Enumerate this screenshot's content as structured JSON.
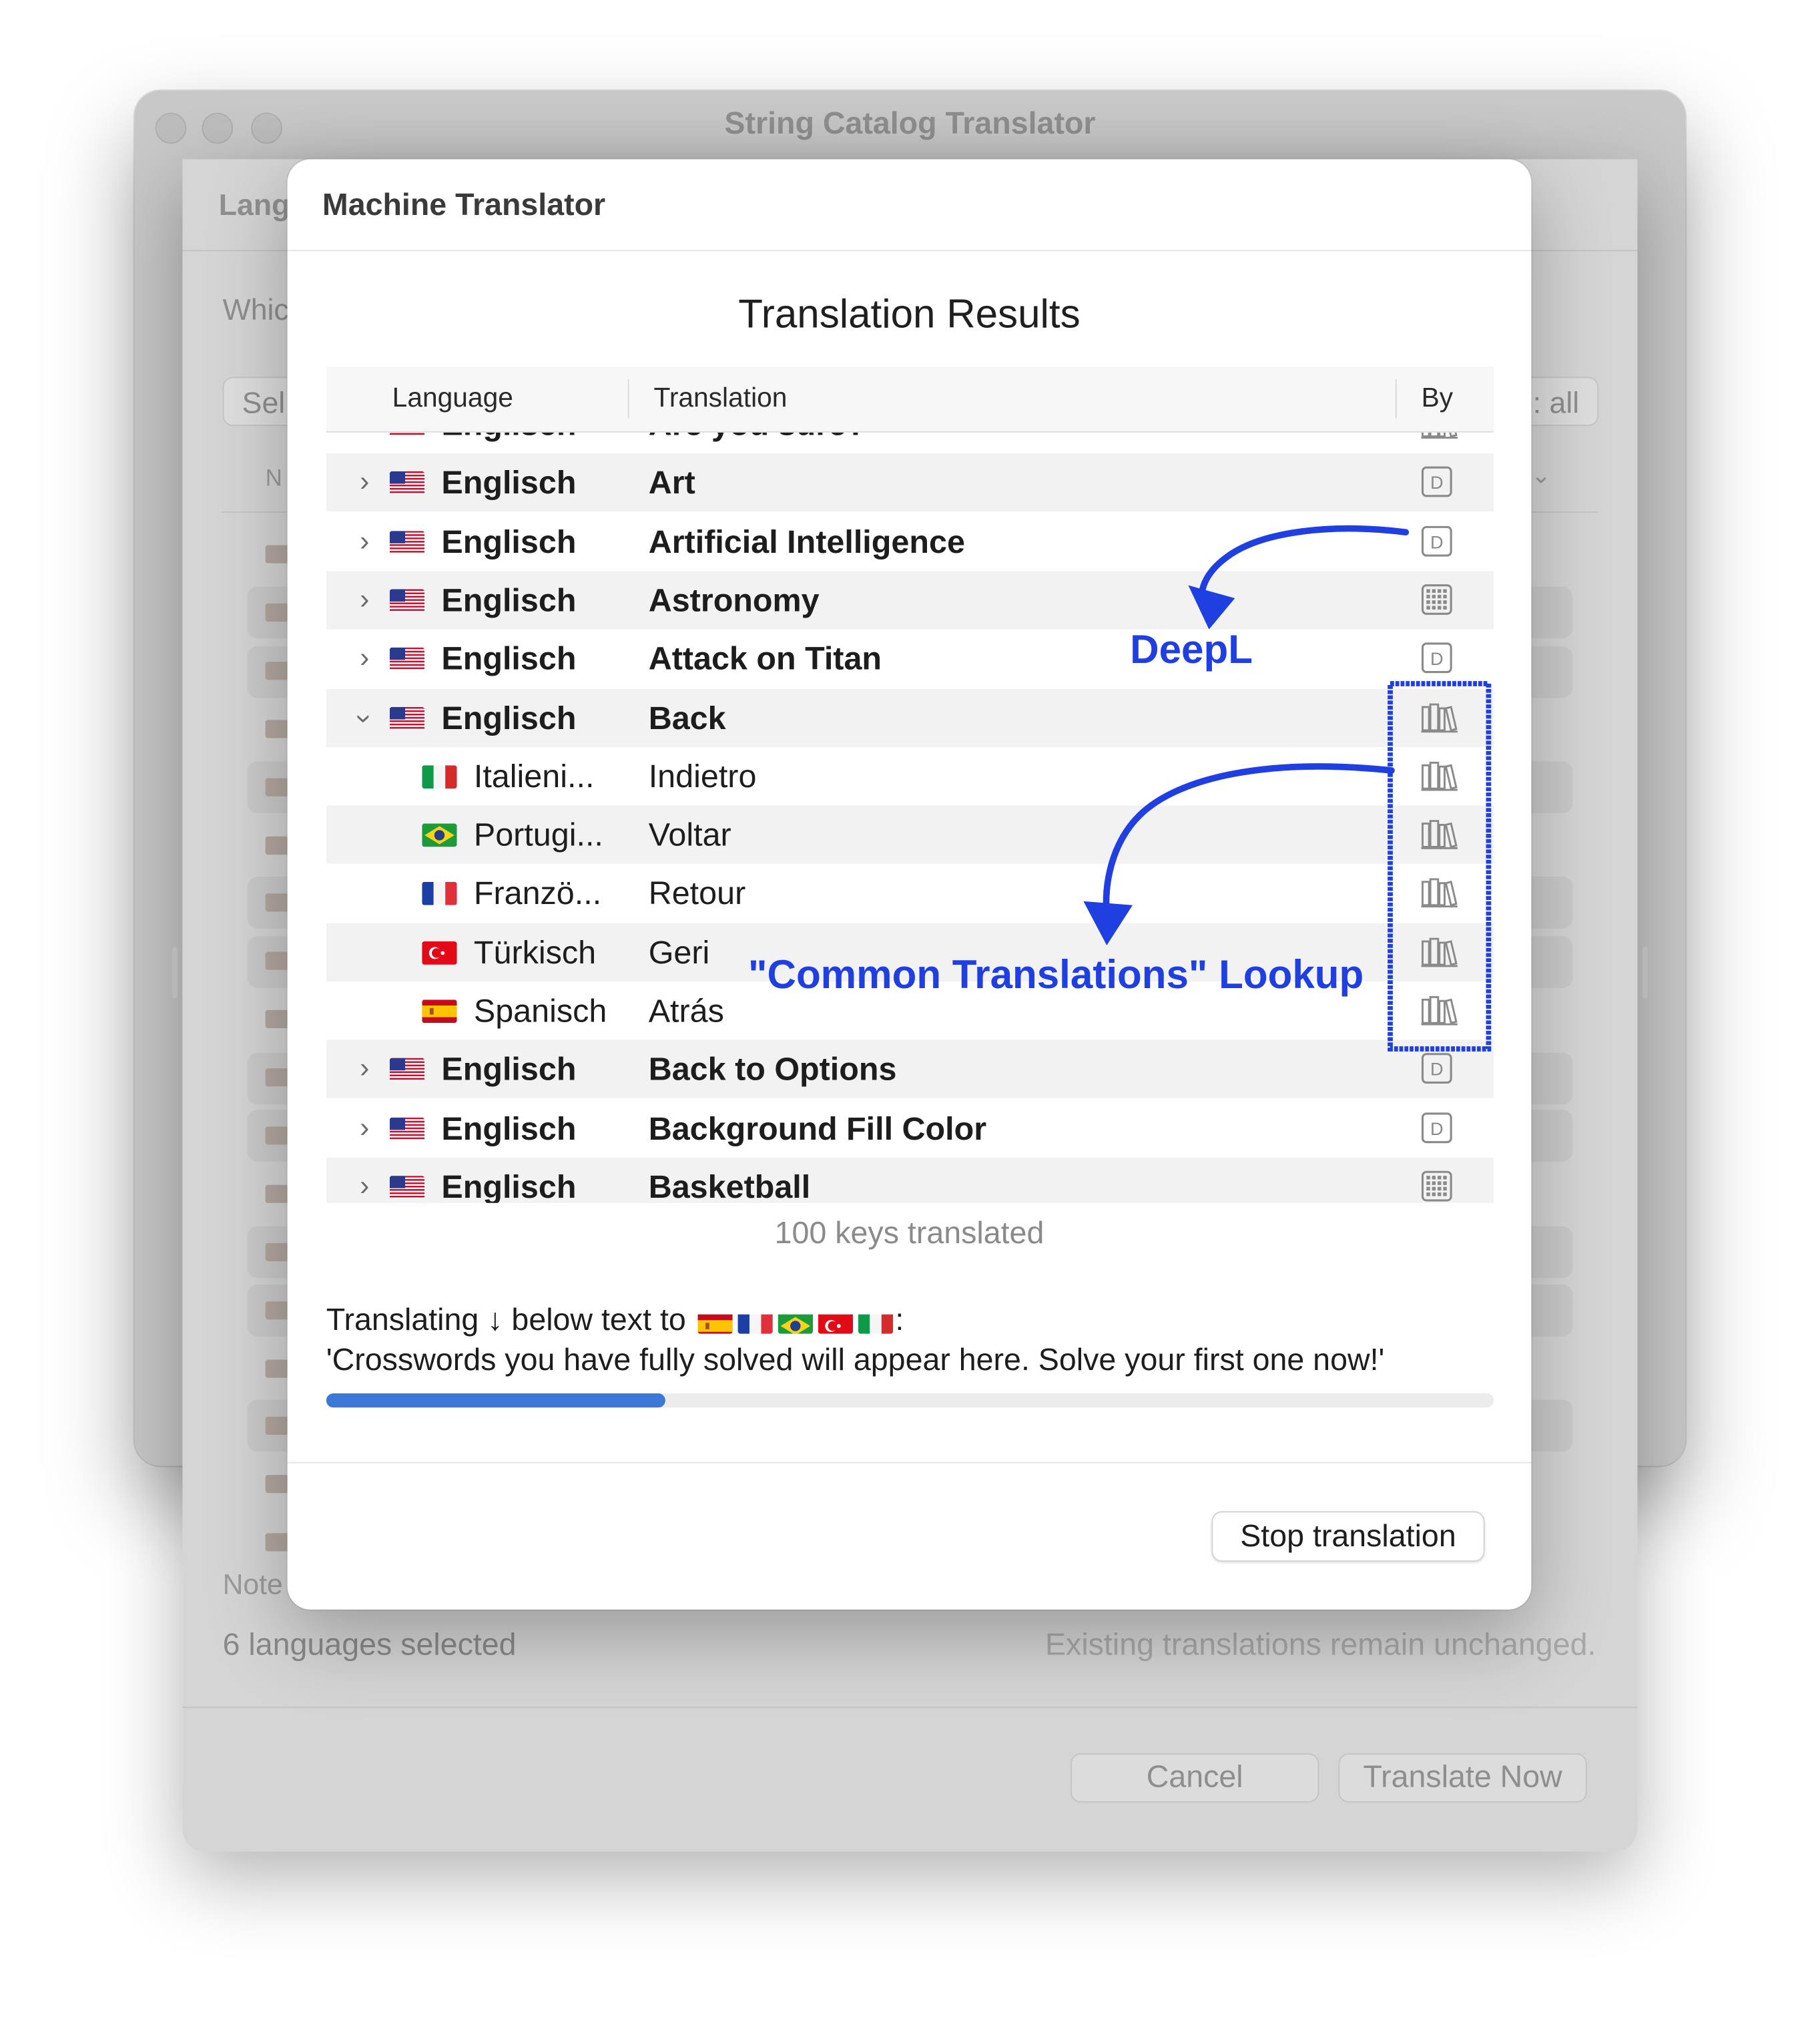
{
  "window": {
    "title": "String Catalog Translator"
  },
  "languages_sheet": {
    "title_partial": "Lang",
    "question_partial": "Whic",
    "select_partial": "Sel",
    "select_all_partial": ": all",
    "column_partial": "N",
    "note_partial": "Note",
    "selected_count": "6 languages selected",
    "existing_note": "Existing translations remain unchanged.",
    "cancel_label": "Cancel",
    "translate_now_label": "Translate Now"
  },
  "modal": {
    "title": "Machine Translator",
    "results_title": "Translation Results",
    "columns": {
      "language": "Language",
      "translation": "Translation",
      "by": "By"
    },
    "rows": [
      {
        "language": "Englisch",
        "translation": "Are you sure?",
        "flag": "us",
        "by_icon": "books-icon",
        "level": 0,
        "expanded": false
      },
      {
        "language": "Englisch",
        "translation": "Art",
        "flag": "us",
        "by_icon": "deepl-icon",
        "level": 0,
        "expanded": false
      },
      {
        "language": "Englisch",
        "translation": "Artificial Intelligence",
        "flag": "us",
        "by_icon": "deepl-icon",
        "level": 0,
        "expanded": false
      },
      {
        "language": "Englisch",
        "translation": "Astronomy",
        "flag": "us",
        "by_icon": "grid-icon",
        "level": 0,
        "expanded": false
      },
      {
        "language": "Englisch",
        "translation": "Attack on Titan",
        "flag": "us",
        "by_icon": "deepl-icon",
        "level": 0,
        "expanded": false
      },
      {
        "language": "Englisch",
        "translation": "Back",
        "flag": "us",
        "by_icon": "books-icon",
        "level": 0,
        "expanded": true
      },
      {
        "language": "Italieni...",
        "translation": "Indietro",
        "flag": "it",
        "by_icon": "books-icon",
        "level": 1
      },
      {
        "language": "Portugi...",
        "translation": "Voltar",
        "flag": "br",
        "by_icon": "books-icon",
        "level": 1
      },
      {
        "language": "Franzö...",
        "translation": "Retour",
        "flag": "fr",
        "by_icon": "books-icon",
        "level": 1
      },
      {
        "language": "Türkisch",
        "translation": "Geri",
        "flag": "tr",
        "by_icon": "books-icon",
        "level": 1
      },
      {
        "language": "Spanisch",
        "translation": "Atrás",
        "flag": "es",
        "by_icon": "books-icon",
        "level": 1
      },
      {
        "language": "Englisch",
        "translation": "Back to Options",
        "flag": "us",
        "by_icon": "deepl-icon",
        "level": 0,
        "expanded": false
      },
      {
        "language": "Englisch",
        "translation": "Background Fill Color",
        "flag": "us",
        "by_icon": "deepl-icon",
        "level": 0,
        "expanded": false
      },
      {
        "language": "Englisch",
        "translation": "Basketball",
        "flag": "us",
        "by_icon": "grid-icon",
        "level": 0,
        "expanded": false
      }
    ],
    "keys_translated": "100 keys translated",
    "translating_prefix": "Translating ↓ below text to",
    "translating_suffix": ":",
    "target_flags": [
      "es",
      "fr",
      "br",
      "tr",
      "it"
    ],
    "current_text": "'Crosswords you have fully solved will appear here. Solve your first one now!'",
    "progress_fraction": 0.29,
    "stop_label": "Stop translation"
  },
  "annotations": {
    "deepl_label": "DeepL",
    "common_label": "\"Common Translations\" Lookup",
    "color": "#1f3fe0"
  }
}
